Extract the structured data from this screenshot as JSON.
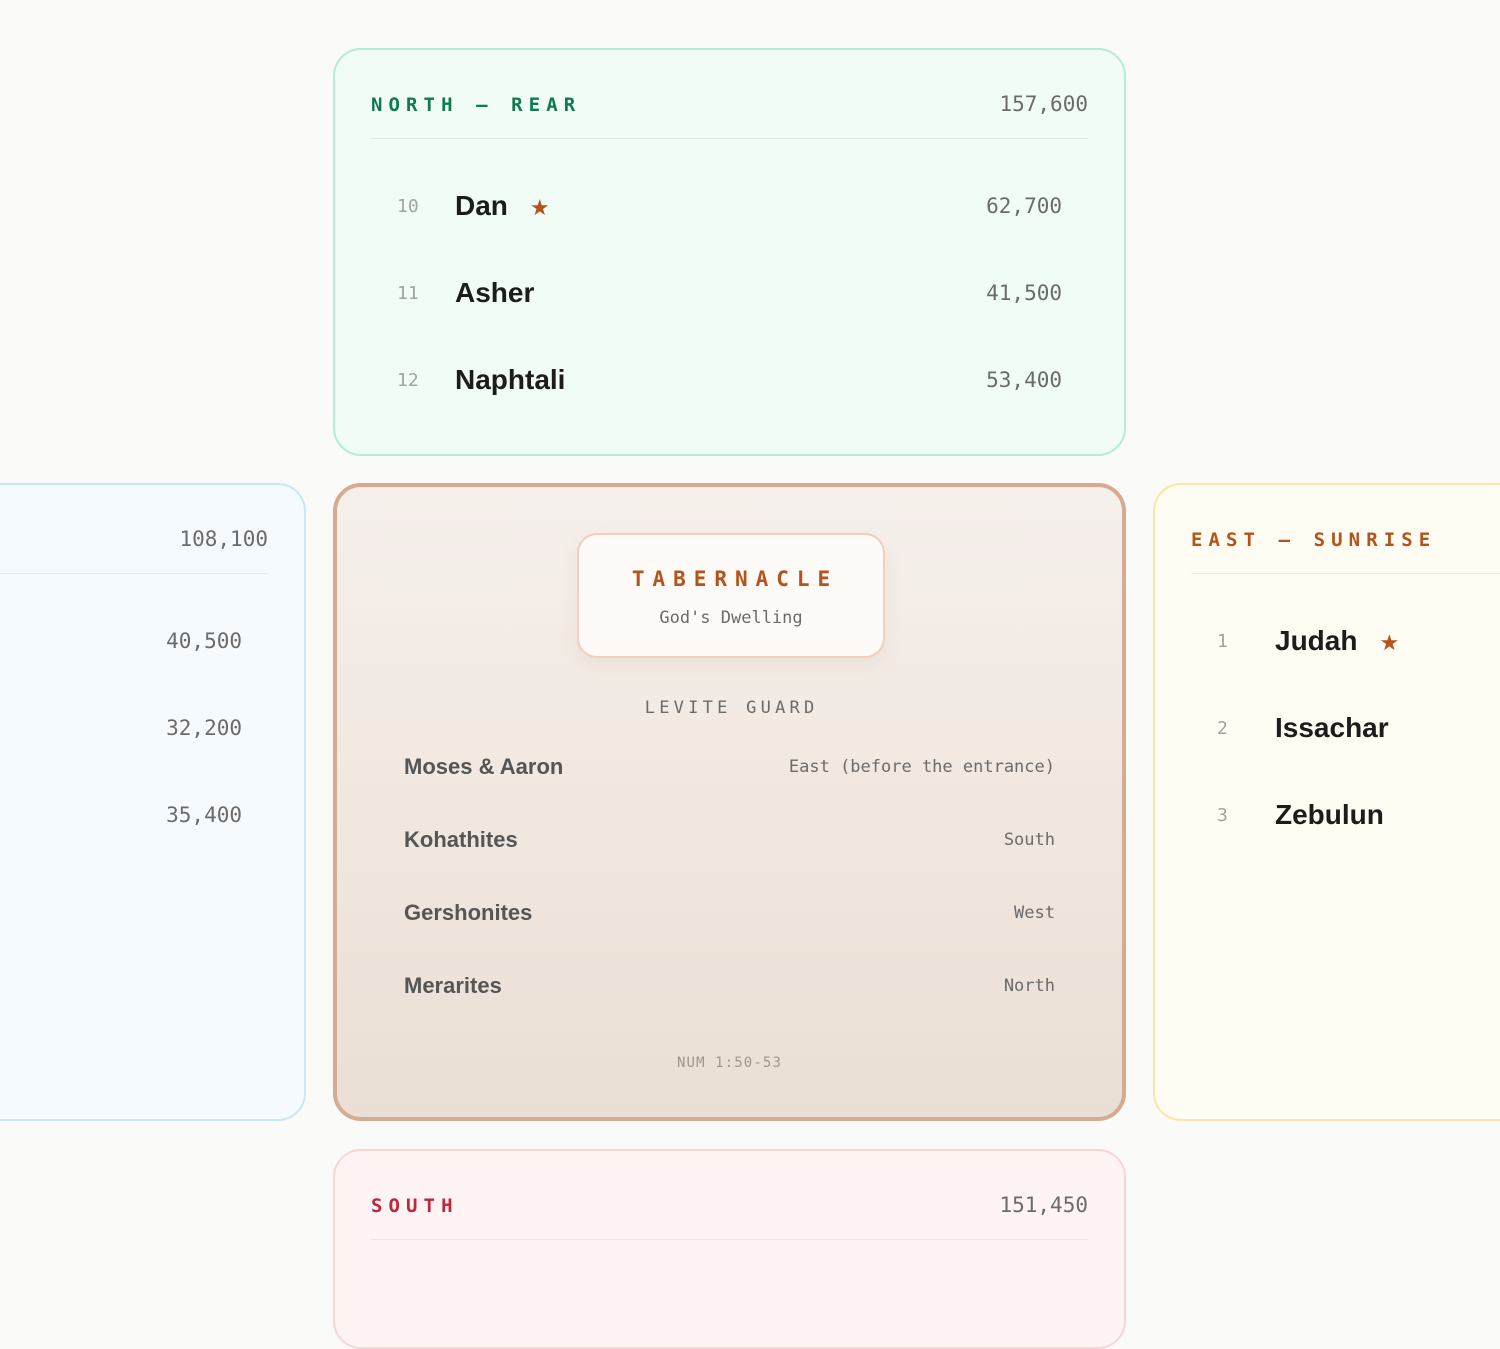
{
  "north": {
    "title": "NORTH — REAR",
    "total": "157,600",
    "tribes": [
      {
        "num": "10",
        "name": "Dan",
        "star": "★",
        "count": "62,700"
      },
      {
        "num": "11",
        "name": "Asher",
        "count": "41,500"
      },
      {
        "num": "12",
        "name": "Naphtali",
        "count": "53,400"
      }
    ]
  },
  "west": {
    "total": "108,100",
    "tribes": [
      {
        "star": "★",
        "count": "40,500"
      },
      {
        "count": "32,200"
      },
      {
        "count": "35,400"
      }
    ]
  },
  "east": {
    "title": "EAST — SUNRISE",
    "tribes": [
      {
        "num": "1",
        "name": "Judah",
        "star": "★"
      },
      {
        "num": "2",
        "name": "Issachar"
      },
      {
        "num": "3",
        "name": "Zebulun"
      }
    ]
  },
  "center": {
    "title": "TABERNACLE",
    "subtitle": "God's Dwelling",
    "guard_label": "LEVITE GUARD",
    "guards": [
      {
        "name": "Moses & Aaron",
        "position": "East (before the entrance)"
      },
      {
        "name": "Kohathites",
        "position": "South"
      },
      {
        "name": "Gershonites",
        "position": "West"
      },
      {
        "name": "Merarites",
        "position": "North"
      }
    ],
    "reference": "NUM 1:50-53"
  },
  "south": {
    "title": "SOUTH",
    "total": "151,450"
  },
  "colors": {
    "north_accent": "#0f7a4f",
    "east_accent": "#b4531a",
    "south_accent": "#c0263b",
    "star": "#b4531a"
  }
}
